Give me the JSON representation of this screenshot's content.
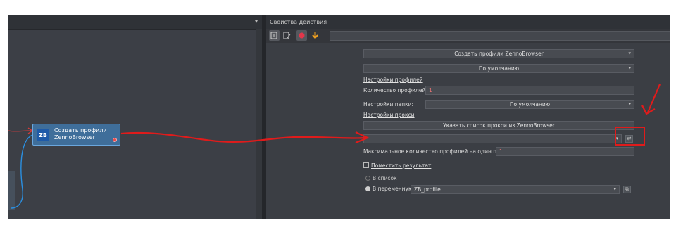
{
  "left_panel": {
    "node_title_line1": "Создать профили",
    "node_title_line2": "ZennoBrowser",
    "node_badge": "ZB",
    "topbar_arrow": "▾"
  },
  "right_panel": {
    "title": "Свойства действия",
    "action_select": "Создать профили ZennoBrowser",
    "mode_select": "По умолчанию",
    "profile_settings_link": "Настройки профилей",
    "profiles_count_label": "Количество профилей:",
    "profiles_count_value": "1",
    "folder_settings_label": "Настройки папки:",
    "folder_settings_value": "По умолчанию",
    "proxy_settings_link": "Настройки прокси",
    "proxy_list_button": "Указать список прокси из ZennoBrowser",
    "proxy_input_value": "",
    "max_profiles_label": "Максимальное количество профилей на один прокси:",
    "max_profiles_value": "1",
    "put_result_link": "Поместить результат",
    "radio_list_label": "В список",
    "radio_var_label": "В переменную",
    "var_value": "ZB_profile"
  },
  "colors": {
    "annotation_red": "#e01b1b",
    "node_blue": "#3f6e9a",
    "connector_blue": "#2b8fe0"
  }
}
